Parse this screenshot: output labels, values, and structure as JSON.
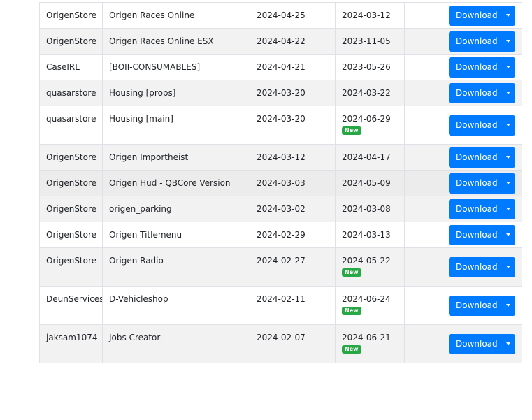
{
  "download_label": "Download",
  "badge_label": "New",
  "colors": {
    "primary": "#007bff",
    "badge": "#28a745",
    "stripe": "#f2f2f2",
    "border": "#dee2e6"
  },
  "rows": [
    {
      "author": "OrigenStore",
      "name": "Origen Races Online",
      "added": "2024-04-25",
      "updated": "2024-03-12",
      "is_new": false
    },
    {
      "author": "OrigenStore",
      "name": "Origen Races Online ESX",
      "added": "2024-04-22",
      "updated": "2023-11-05",
      "is_new": false
    },
    {
      "author": "CaseIRL",
      "name": "[BOII-CONSUMABLES]",
      "added": "2024-04-21",
      "updated": "2023-05-26",
      "is_new": false
    },
    {
      "author": "quasarstore",
      "name": "Housing [props]",
      "added": "2024-03-20",
      "updated": "2024-03-22",
      "is_new": false
    },
    {
      "author": "quasarstore",
      "name": "Housing [main]",
      "added": "2024-03-20",
      "updated": "2024-06-29",
      "is_new": true
    },
    {
      "author": "OrigenStore",
      "name": "Origen Importheist",
      "added": "2024-03-12",
      "updated": "2024-04-17",
      "is_new": false
    },
    {
      "author": "OrigenStore",
      "name": "Origen Hud - QBCore Version",
      "added": "2024-03-03",
      "updated": "2024-05-09",
      "is_new": false
    },
    {
      "author": "OrigenStore",
      "name": "origen_parking",
      "added": "2024-03-02",
      "updated": "2024-03-08",
      "is_new": false
    },
    {
      "author": "OrigenStore",
      "name": "Origen Titlemenu",
      "added": "2024-02-29",
      "updated": "2024-03-13",
      "is_new": false
    },
    {
      "author": "OrigenStore",
      "name": "Origen Radio",
      "added": "2024-02-27",
      "updated": "2024-05-22",
      "is_new": true
    },
    {
      "author": "DeunServices",
      "name": "D-Vehicleshop",
      "added": "2024-02-11",
      "updated": "2024-06-24",
      "is_new": true
    },
    {
      "author": "jaksam1074",
      "name": "Jobs Creator",
      "added": "2024-02-07",
      "updated": "2024-06-21",
      "is_new": true
    }
  ]
}
